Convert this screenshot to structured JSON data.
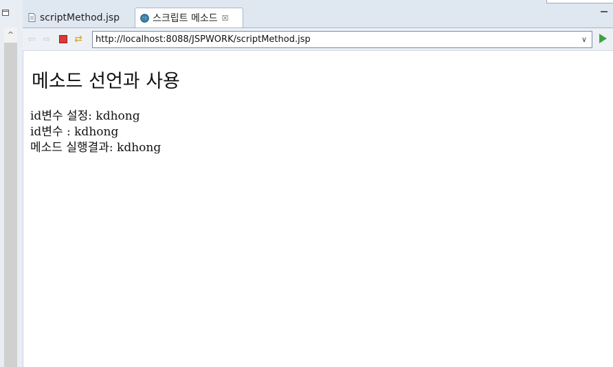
{
  "tabs": [
    {
      "label": "scriptMethod.jsp",
      "icon": "jsp-file-icon",
      "active": false
    },
    {
      "label": "스크립트 메소드",
      "icon": "globe-icon",
      "active": true,
      "close": "☒"
    }
  ],
  "toolbar": {
    "url": "http://localhost:8088/JSPWORK/scriptMethod.jsp"
  },
  "page": {
    "heading": "메소드 선언과 사용",
    "lines": [
      "id변수 설정: kdhong",
      "id변수 : kdhong",
      "메소드 실행결과: kdhong"
    ]
  },
  "colors": {
    "stop": "#d83a3a",
    "go": "#3fa33f",
    "refresh": "#d3a225"
  }
}
